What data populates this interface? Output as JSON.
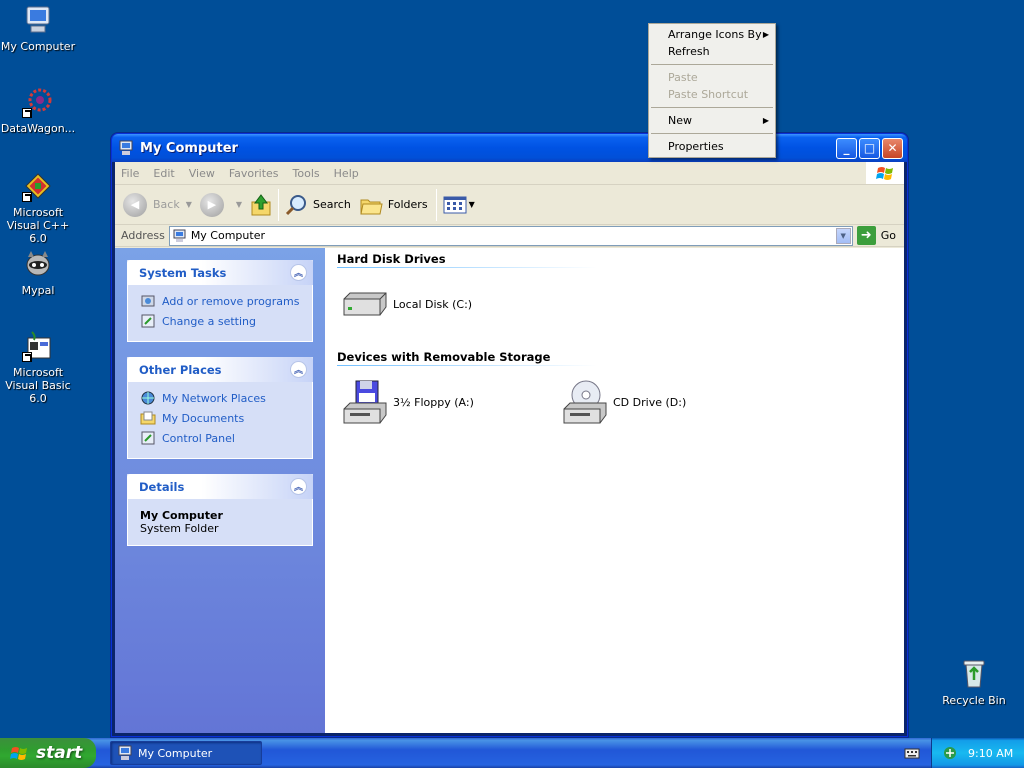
{
  "desktop": {
    "icons": [
      {
        "label": "My Computer"
      },
      {
        "label": "DataWagon..."
      },
      {
        "label": "Microsoft Visual C++ 6.0"
      },
      {
        "label": "Mypal"
      },
      {
        "label": "Microsoft Visual Basic 6.0"
      },
      {
        "label": "Recycle Bin"
      }
    ]
  },
  "context_menu": {
    "items": [
      {
        "label": "Arrange Icons By",
        "submenu": true,
        "enabled": true
      },
      {
        "label": "Refresh",
        "enabled": true
      },
      {
        "label": "Paste",
        "enabled": false
      },
      {
        "label": "Paste Shortcut",
        "enabled": false
      },
      {
        "label": "New",
        "submenu": true,
        "enabled": true
      },
      {
        "label": "Properties",
        "enabled": true
      }
    ]
  },
  "window": {
    "title": "My Computer",
    "menu": [
      "File",
      "Edit",
      "View",
      "Favorites",
      "Tools",
      "Help"
    ],
    "toolbar": {
      "back": "Back",
      "search": "Search",
      "folders": "Folders"
    },
    "address": {
      "label": "Address",
      "value": "My Computer",
      "go": "Go"
    },
    "task_pane": {
      "system_tasks": {
        "title": "System Tasks",
        "links": [
          "Add or remove programs",
          "Change a setting"
        ]
      },
      "other_places": {
        "title": "Other Places",
        "links": [
          "My Network Places",
          "My Documents",
          "Control Panel"
        ]
      },
      "details": {
        "title": "Details",
        "name": "My Computer",
        "type": "System Folder"
      }
    },
    "groups": {
      "hard_disks": {
        "title": "Hard Disk Drives",
        "items": [
          "Local Disk (C:)"
        ]
      },
      "removable": {
        "title": "Devices with Removable Storage",
        "items": [
          "3½ Floppy (A:)",
          "CD Drive (D:)"
        ]
      }
    }
  },
  "taskbar": {
    "start": "start",
    "task": "My Computer",
    "clock": "9:10 AM"
  }
}
